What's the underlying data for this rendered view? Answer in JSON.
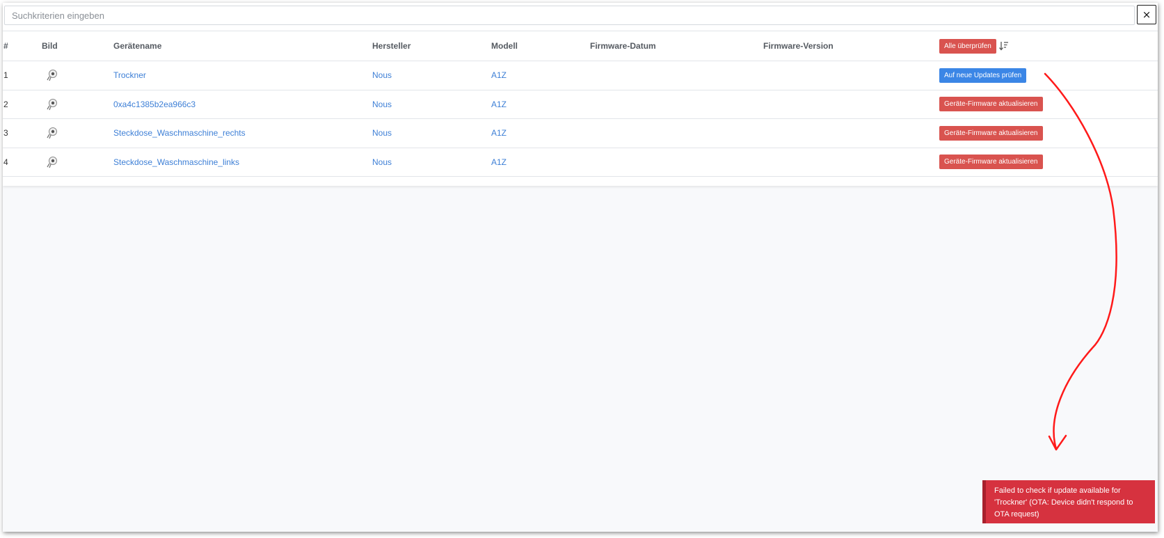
{
  "search": {
    "placeholder": "Suchkriterien eingeben",
    "clear_label": "×"
  },
  "table": {
    "headers": {
      "num": "#",
      "image": "Bild",
      "name": "Gerätename",
      "manufacturer": "Hersteller",
      "model": "Modell",
      "firmware_date": "Firmware-Datum",
      "firmware_version": "Firmware-Version",
      "check_all": "Alle überprüfen"
    },
    "rows": [
      {
        "num": "1",
        "name": "Trockner",
        "manufacturer": "Nous",
        "model": "A1Z",
        "firmware_date": "",
        "firmware_version": "",
        "action": "Auf neue Updates prüfen",
        "action_type": "check"
      },
      {
        "num": "2",
        "name": "0xa4c1385b2ea966c3",
        "manufacturer": "Nous",
        "model": "A1Z",
        "firmware_date": "",
        "firmware_version": "",
        "action": "Geräte-Firmware aktualisieren",
        "action_type": "update"
      },
      {
        "num": "3",
        "name": "Steckdose_Waschmaschine_rechts",
        "manufacturer": "Nous",
        "model": "A1Z",
        "firmware_date": "",
        "firmware_version": "",
        "action": "Geräte-Firmware aktualisieren",
        "action_type": "update"
      },
      {
        "num": "4",
        "name": "Steckdose_Waschmaschine_links",
        "manufacturer": "Nous",
        "model": "A1Z",
        "firmware_date": "",
        "firmware_version": "",
        "action": "Geräte-Firmware aktualisieren",
        "action_type": "update"
      }
    ]
  },
  "toast": {
    "message": "Failed to check if update available for 'Trockner' (OTA: Device didn't respond to OTA request)"
  },
  "colors": {
    "danger": "#d9534f",
    "primary": "#3b86e6",
    "link": "#3d7fd6",
    "toast": "#d6323f",
    "annotation_arrow": "#ff0000"
  },
  "icons": {
    "clear": "close-icon",
    "sort": "sort-descending-icon",
    "device": "plug-device-icon"
  }
}
